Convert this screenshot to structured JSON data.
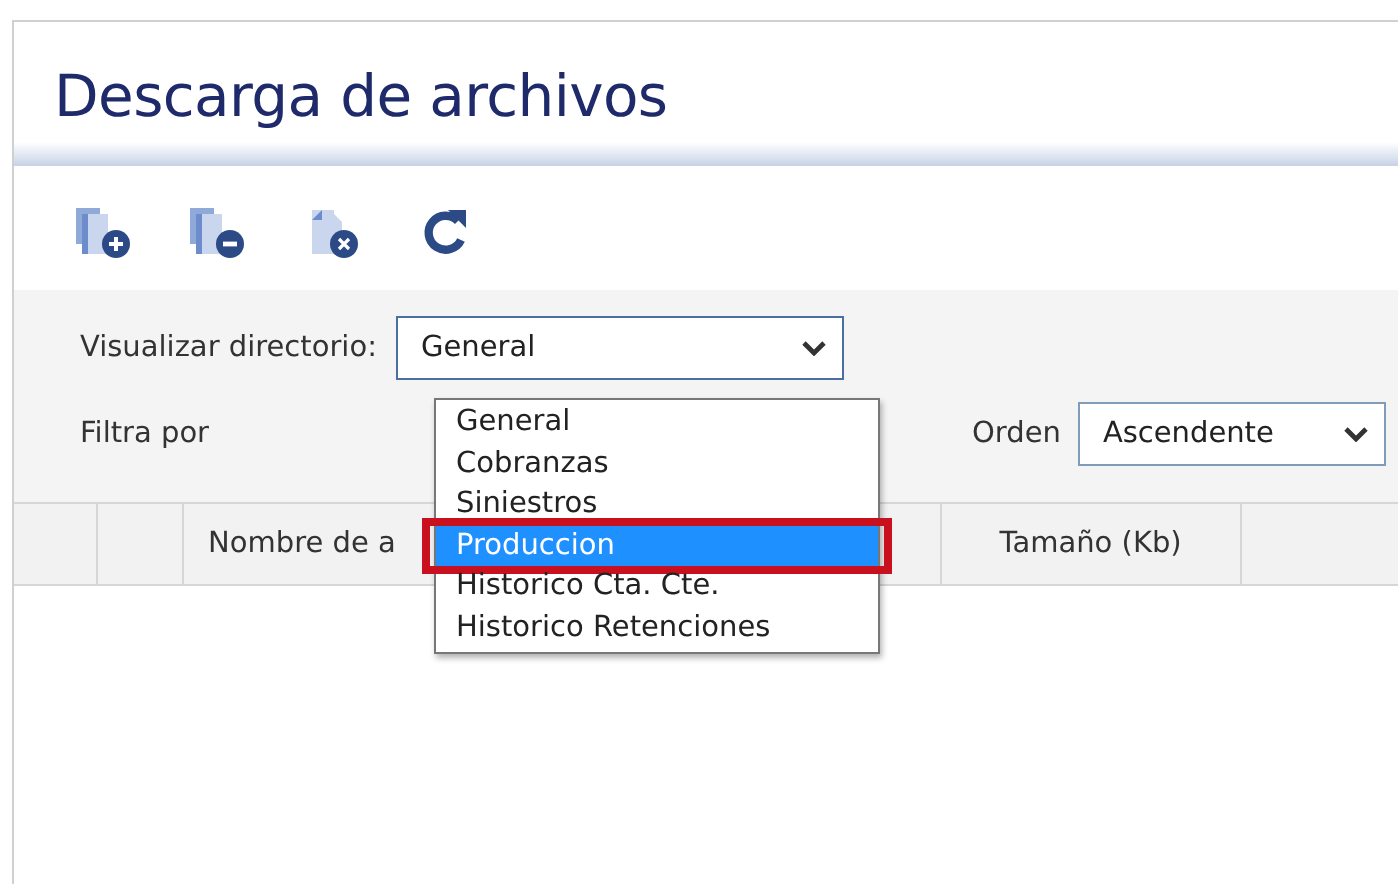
{
  "title": "Descarga de archivos",
  "toolbar": [
    {
      "kind": "add"
    },
    {
      "kind": "remove"
    },
    {
      "kind": "delete"
    },
    {
      "kind": "refresh"
    }
  ],
  "directory": {
    "label": "Visualizar directorio:",
    "value": "General",
    "expanded": true,
    "options": [
      {
        "label": "General",
        "highlighted": false,
        "marked": false
      },
      {
        "label": "Cobranzas",
        "highlighted": false,
        "marked": false
      },
      {
        "label": "Siniestros",
        "highlighted": false,
        "marked": false
      },
      {
        "label": "Produccion",
        "highlighted": true,
        "marked": true
      },
      {
        "label": "Historico Cta. Cte.",
        "highlighted": false,
        "marked": false
      },
      {
        "label": "Historico Retenciones",
        "highlighted": false,
        "marked": false
      }
    ]
  },
  "filter": {
    "label": "Filtra por"
  },
  "order": {
    "label": "Orden",
    "value": "Ascendente"
  },
  "table": {
    "columns": [
      {
        "label": "Nombre de a"
      },
      {
        "label": "Tamaño (Kb)"
      }
    ]
  }
}
